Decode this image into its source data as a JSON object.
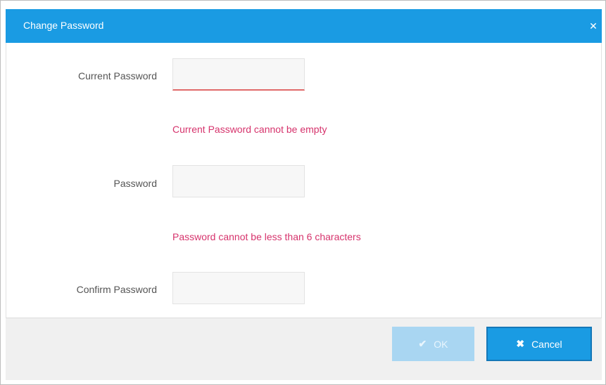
{
  "dialog": {
    "title": "Change Password",
    "close_icon": "close-icon"
  },
  "form": {
    "current_password": {
      "label": "Current Password",
      "value": "",
      "error": "Current Password cannot be empty"
    },
    "password": {
      "label": "Password",
      "value": "",
      "error": "Password cannot be less than 6 characters"
    },
    "confirm_password": {
      "label": "Confirm Password",
      "value": ""
    }
  },
  "buttons": {
    "ok": {
      "label": "OK",
      "icon": "check-icon",
      "enabled": false
    },
    "cancel": {
      "label": "Cancel",
      "icon": "close-icon"
    }
  },
  "colors": {
    "accent": "#1a9be3",
    "error": "#d6336c",
    "disabled_button": "#a9d6f2"
  }
}
